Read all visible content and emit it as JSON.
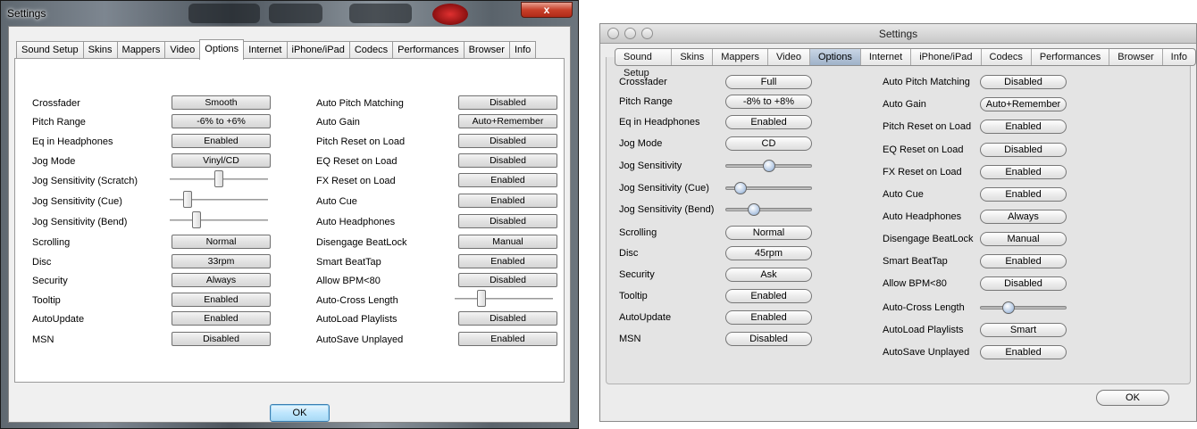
{
  "windows_dialog": {
    "title": "Settings",
    "close_label": "x",
    "tabs": [
      "Sound Setup",
      "Skins",
      "Mappers",
      "Video",
      "Options",
      "Internet",
      "iPhone/iPad",
      "Codecs",
      "Performances",
      "Browser",
      "Info"
    ],
    "selected_tab": "Options",
    "left_column": [
      {
        "label": "Crossfader",
        "type": "button",
        "value": "Smooth"
      },
      {
        "label": "Pitch Range",
        "type": "button",
        "value": "-6% to +6%"
      },
      {
        "label": "Eq in Headphones",
        "type": "button",
        "value": "Enabled"
      },
      {
        "label": "Jog Mode",
        "type": "button",
        "value": "Vinyl/CD"
      },
      {
        "label": "Jog Sensitivity (Scratch)",
        "type": "slider",
        "level": 0.5
      },
      {
        "label": "Jog Sensitivity (Cue)",
        "type": "slider",
        "level": 0.15
      },
      {
        "label": "Jog Sensitivity (Bend)",
        "type": "slider",
        "level": 0.25
      },
      {
        "label": "Scrolling",
        "type": "button",
        "value": "Normal"
      },
      {
        "label": "Disc",
        "type": "button",
        "value": "33rpm"
      },
      {
        "label": "Security",
        "type": "button",
        "value": "Always"
      },
      {
        "label": "Tooltip",
        "type": "button",
        "value": "Enabled"
      },
      {
        "label": "AutoUpdate",
        "type": "button",
        "value": "Enabled"
      },
      {
        "label": "MSN",
        "type": "button",
        "value": "Disabled"
      }
    ],
    "right_column": [
      {
        "label": "Auto Pitch Matching",
        "type": "button",
        "value": "Disabled"
      },
      {
        "label": "Auto Gain",
        "type": "button",
        "value": "Auto+Remember"
      },
      {
        "label": "Pitch Reset on Load",
        "type": "button",
        "value": "Disabled"
      },
      {
        "label": "EQ Reset on Load",
        "type": "button",
        "value": "Disabled"
      },
      {
        "label": "FX Reset on Load",
        "type": "button",
        "value": "Enabled"
      },
      {
        "label": "Auto Cue",
        "type": "button",
        "value": "Enabled"
      },
      {
        "label": "Auto Headphones",
        "type": "button",
        "value": "Disabled"
      },
      {
        "label": "Disengage BeatLock",
        "type": "button",
        "value": "Manual"
      },
      {
        "label": "Smart BeatTap",
        "type": "button",
        "value": "Enabled"
      },
      {
        "label": "Allow BPM<80",
        "type": "button",
        "value": "Disabled"
      },
      {
        "label": "Auto-Cross Length",
        "type": "slider",
        "level": 0.25
      },
      {
        "label": "AutoLoad Playlists",
        "type": "button",
        "value": "Disabled"
      },
      {
        "label": "AutoSave Unplayed",
        "type": "button",
        "value": "Enabled"
      }
    ],
    "ok_label": "OK"
  },
  "mac_dialog": {
    "title": "Settings",
    "tabs": [
      "Sound Setup",
      "Skins",
      "Mappers",
      "Video",
      "Options",
      "Internet",
      "iPhone/iPad",
      "Codecs",
      "Performances",
      "Browser",
      "Info"
    ],
    "selected_tab": "Options",
    "left_column": [
      {
        "label": "Crossfader",
        "type": "button",
        "value": "Full"
      },
      {
        "label": "Pitch Range",
        "type": "button",
        "value": "-8% to +8%"
      },
      {
        "label": "Eq in Headphones",
        "type": "button",
        "value": "Enabled"
      },
      {
        "label": "Jog Mode",
        "type": "button",
        "value": "CD"
      },
      {
        "label": "Jog Sensitivity",
        "type": "slider",
        "level": 0.5
      },
      {
        "label": "Jog Sensitivity (Cue)",
        "type": "slider",
        "level": 0.12
      },
      {
        "label": "Jog Sensitivity (Bend)",
        "type": "slider",
        "level": 0.3
      },
      {
        "label": "Scrolling",
        "type": "button",
        "value": "Normal"
      },
      {
        "label": "Disc",
        "type": "button",
        "value": "45rpm"
      },
      {
        "label": "Security",
        "type": "button",
        "value": "Ask"
      },
      {
        "label": "Tooltip",
        "type": "button",
        "value": "Enabled"
      },
      {
        "label": "AutoUpdate",
        "type": "button",
        "value": "Enabled"
      },
      {
        "label": "MSN",
        "type": "button",
        "value": "Disabled"
      }
    ],
    "right_column": [
      {
        "label": "Auto Pitch Matching",
        "type": "button",
        "value": "Disabled"
      },
      {
        "label": "Auto Gain",
        "type": "button",
        "value": "Auto+Remember"
      },
      {
        "label": "Pitch Reset on Load",
        "type": "button",
        "value": "Enabled"
      },
      {
        "label": "EQ Reset on Load",
        "type": "button",
        "value": "Disabled"
      },
      {
        "label": "FX Reset on Load",
        "type": "button",
        "value": "Enabled"
      },
      {
        "label": "Auto Cue",
        "type": "button",
        "value": "Enabled"
      },
      {
        "label": "Auto Headphones",
        "type": "button",
        "value": "Always"
      },
      {
        "label": "Disengage BeatLock",
        "type": "button",
        "value": "Manual"
      },
      {
        "label": "Smart BeatTap",
        "type": "button",
        "value": "Enabled"
      },
      {
        "label": "Allow BPM<80",
        "type": "button",
        "value": "Disabled"
      },
      {
        "label": "Auto-Cross Length",
        "type": "slider",
        "level": 0.3
      },
      {
        "label": "AutoLoad Playlists",
        "type": "button",
        "value": "Smart"
      },
      {
        "label": "AutoSave Unplayed",
        "type": "button",
        "value": "Enabled"
      }
    ],
    "ok_label": "OK"
  }
}
